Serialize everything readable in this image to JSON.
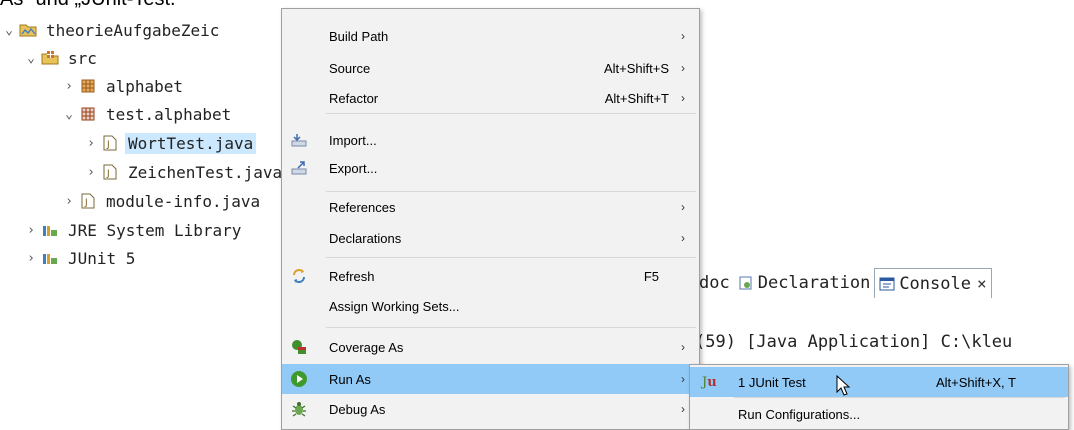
{
  "heading": "As“ und „JUnit-Test.",
  "tree": {
    "project": "theorieAufgabeZeic",
    "src": "src",
    "pkg_alphabet": "alphabet",
    "pkg_test_alphabet": "test.alphabet",
    "file_worttest": "WortTest.java",
    "file_zeichentest": "ZeichenTest.java",
    "file_moduleinfo": "module-info.java",
    "jre": "JRE System Library",
    "junit": "JUnit 5"
  },
  "views": {
    "tab_javadoc": "doc",
    "tab_declaration": "Declaration",
    "tab_console": "Console",
    "tab_close": "×",
    "console_line": "(59) [Java Application] C:\\kleu"
  },
  "menu": {
    "build_path": "Build Path",
    "source": "Source",
    "source_accel": "Alt+Shift+S",
    "refactor": "Refactor",
    "refactor_accel": "Alt+Shift+T",
    "import": "Import...",
    "export": "Export...",
    "references": "References",
    "declarations": "Declarations",
    "refresh": "Refresh",
    "refresh_accel": "F5",
    "assign_working_sets": "Assign Working Sets...",
    "coverage_as": "Coverage As",
    "run_as": "Run As",
    "debug_as": "Debug As",
    "submenu_arrow": "›"
  },
  "submenu": {
    "junit_test": "1 JUnit Test",
    "junit_test_accel": "Alt+Shift+X, T",
    "run_configurations": "Run Configurations..."
  },
  "colors": {
    "menu_bg": "#f2f2f2",
    "hover": "#91c9f7",
    "selection": "#cce8ff"
  }
}
